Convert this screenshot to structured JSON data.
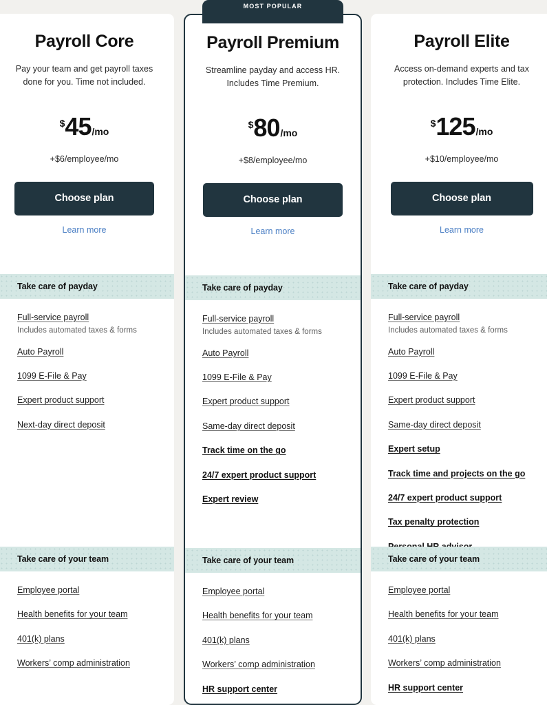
{
  "badge": {
    "label": "MOST POPULAR",
    "for_plan": "Payroll Premium"
  },
  "colors": {
    "page_background": "#f2f1ee",
    "card_background": "#ffffff",
    "accent_dark": "#21353f",
    "band_mint": "#d4e7e4",
    "link_blue": "#4b7fc4",
    "text_primary": "#121212",
    "text_muted": "#5e5e5e"
  },
  "sections": {
    "payday": {
      "label": "Take care of payday"
    },
    "team": {
      "label": "Take care of your team"
    }
  },
  "plans": [
    {
      "name": "Payroll Core",
      "description": "Pay your team and get payroll taxes done for you. Time not included.",
      "price": {
        "currency": "$",
        "amount": "45",
        "period": "/mo"
      },
      "per_employee": "+$6/employee/mo",
      "cta_label": "Choose plan",
      "learn_more_label": "Learn more",
      "most_popular": false,
      "payday_features": [
        {
          "label": "Full-service payroll",
          "sub": "Includes automated taxes & forms",
          "highlight": false
        },
        {
          "label": "Auto Payroll",
          "sub": "",
          "highlight": false
        },
        {
          "label": "1099 E-File & Pay",
          "sub": "",
          "highlight": false
        },
        {
          "label": "Expert product support",
          "sub": "",
          "highlight": false
        },
        {
          "label": "Next-day direct deposit",
          "sub": "",
          "highlight": false
        }
      ],
      "team_features": [
        {
          "label": "Employee portal",
          "sub": "",
          "highlight": false
        },
        {
          "label": "Health benefits for your team",
          "sub": "",
          "highlight": false
        },
        {
          "label": "401(k) plans",
          "sub": "",
          "highlight": false
        },
        {
          "label": "Workers’ comp administration",
          "sub": "",
          "highlight": false
        }
      ]
    },
    {
      "name": "Payroll Premium",
      "description": "Streamline payday and access HR. Includes Time Premium.",
      "price": {
        "currency": "$",
        "amount": "80",
        "period": "/mo"
      },
      "per_employee": "+$8/employee/mo",
      "cta_label": "Choose plan",
      "learn_more_label": "Learn more",
      "most_popular": true,
      "payday_features": [
        {
          "label": "Full-service payroll",
          "sub": "Includes automated taxes & forms",
          "highlight": false
        },
        {
          "label": "Auto Payroll",
          "sub": "",
          "highlight": false
        },
        {
          "label": "1099 E-File & Pay",
          "sub": "",
          "highlight": false
        },
        {
          "label": "Expert product support",
          "sub": "",
          "highlight": false
        },
        {
          "label": "Same-day direct deposit",
          "sub": "",
          "highlight": false
        },
        {
          "label": "Track time on the go",
          "sub": "",
          "highlight": true
        },
        {
          "label": "24/7 expert product support",
          "sub": "",
          "highlight": true
        },
        {
          "label": "Expert review",
          "sub": "",
          "highlight": true
        }
      ],
      "team_features": [
        {
          "label": "Employee portal",
          "sub": "",
          "highlight": false
        },
        {
          "label": "Health benefits for your team",
          "sub": "",
          "highlight": false
        },
        {
          "label": "401(k) plans",
          "sub": "",
          "highlight": false
        },
        {
          "label": "Workers’ comp administration",
          "sub": "",
          "highlight": false
        },
        {
          "label": "HR support center",
          "sub": "",
          "highlight": true
        }
      ]
    },
    {
      "name": "Payroll Elite",
      "description": "Access on-demand experts and tax protection. Includes Time Elite.",
      "price": {
        "currency": "$",
        "amount": "125",
        "period": "/mo"
      },
      "per_employee": "+$10/employee/mo",
      "cta_label": "Choose plan",
      "learn_more_label": "Learn more",
      "most_popular": false,
      "payday_features": [
        {
          "label": "Full-service payroll",
          "sub": "Includes automated taxes & forms",
          "highlight": false
        },
        {
          "label": "Auto Payroll",
          "sub": "",
          "highlight": false
        },
        {
          "label": "1099 E-File & Pay",
          "sub": "",
          "highlight": false
        },
        {
          "label": "Expert product support",
          "sub": "",
          "highlight": false
        },
        {
          "label": "Same-day direct deposit",
          "sub": "",
          "highlight": false
        },
        {
          "label": "Expert setup",
          "sub": "",
          "highlight": true
        },
        {
          "label": "Track time and projects on the go",
          "sub": "",
          "highlight": true
        },
        {
          "label": "24/7 expert product support",
          "sub": "",
          "highlight": true
        },
        {
          "label": "Tax penalty protection",
          "sub": "",
          "highlight": true
        },
        {
          "label": "Personal HR advisor",
          "sub": "",
          "highlight": true
        }
      ],
      "team_features": [
        {
          "label": "Employee portal",
          "sub": "",
          "highlight": false
        },
        {
          "label": "Health benefits for your team",
          "sub": "",
          "highlight": false
        },
        {
          "label": "401(k) plans",
          "sub": "",
          "highlight": false
        },
        {
          "label": "Workers’ comp administration",
          "sub": "",
          "highlight": false
        },
        {
          "label": "HR support center",
          "sub": "",
          "highlight": true
        }
      ]
    }
  ]
}
